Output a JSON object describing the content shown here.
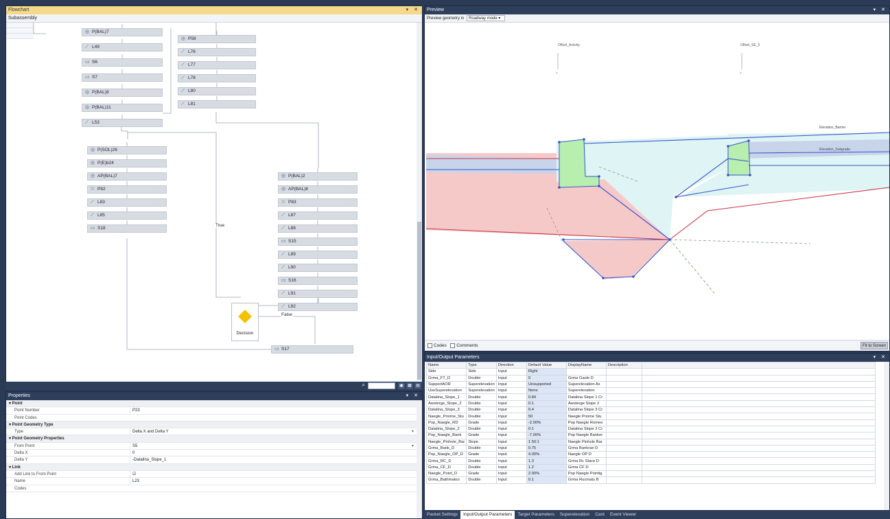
{
  "flowchart": {
    "title": "Flowchart",
    "tab": "Subassembly",
    "col1": [
      {
        "label": "P(BAL)7",
        "icon": "point"
      },
      {
        "label": "L49",
        "icon": "link"
      },
      {
        "label": "S6",
        "icon": "shape"
      },
      {
        "label": "S7",
        "icon": "shape"
      },
      {
        "label": "P(BAL)8",
        "icon": "point"
      },
      {
        "label": "P(BAL)11",
        "icon": "point"
      },
      {
        "label": "L53",
        "icon": "link"
      }
    ],
    "col2": [
      {
        "label": "P58",
        "icon": "point"
      },
      {
        "label": "L76",
        "icon": "link"
      },
      {
        "label": "L77",
        "icon": "link"
      },
      {
        "label": "L78",
        "icon": "link"
      },
      {
        "label": "L80",
        "icon": "link"
      },
      {
        "label": "L81",
        "icon": "link"
      }
    ],
    "col3": [
      {
        "label": "P(SOL)26",
        "icon": "point"
      },
      {
        "label": "P(E)b24",
        "icon": "point"
      },
      {
        "label": "AP(BAL)7",
        "icon": "point"
      },
      {
        "label": "P82",
        "icon": "cross"
      },
      {
        "label": "L83",
        "icon": "link"
      },
      {
        "label": "L85",
        "icon": "link"
      },
      {
        "label": "S18",
        "icon": "shape"
      }
    ],
    "col4": [
      {
        "label": "P(BAL)2",
        "icon": "point"
      },
      {
        "label": "AP(BAL)8",
        "icon": "point"
      },
      {
        "label": "P83",
        "icon": "cross"
      },
      {
        "label": "L87",
        "icon": "link"
      },
      {
        "label": "L88",
        "icon": "link"
      },
      {
        "label": "S15",
        "icon": "shape"
      },
      {
        "label": "L89",
        "icon": "link"
      },
      {
        "label": "L90",
        "icon": "link"
      },
      {
        "label": "S16",
        "icon": "shape"
      },
      {
        "label": "L91",
        "icon": "link"
      },
      {
        "label": "L92",
        "icon": "link"
      }
    ],
    "final_node": {
      "label": "S17",
      "icon": "shape"
    },
    "decision_label": "Decision",
    "true_label": "True",
    "false_label": "False"
  },
  "properties": {
    "title": "Properties",
    "rows": [
      {
        "kind": "cat",
        "name": "Point"
      },
      {
        "kind": "prop",
        "name": "Point Number",
        "value": "P23"
      },
      {
        "kind": "prop",
        "name": "Point Codes",
        "value": ""
      },
      {
        "kind": "cat",
        "name": "Point Geometry Type"
      },
      {
        "kind": "prop",
        "name": "Type",
        "value": "Delta X and Delta Y",
        "dropdown": true
      },
      {
        "kind": "cat",
        "name": "Point Geometry Properties"
      },
      {
        "kind": "prop",
        "name": "From Point",
        "value": "S5",
        "dropdown": true
      },
      {
        "kind": "prop",
        "name": "Delta X",
        "value": "0"
      },
      {
        "kind": "prop",
        "name": "Delta Y",
        "value": "-Datalina_Slope_1"
      },
      {
        "kind": "cat",
        "name": "Link"
      },
      {
        "kind": "prop",
        "name": "Add Link to From Point",
        "value": "☑"
      },
      {
        "kind": "prop",
        "name": "Name",
        "value": "L23"
      },
      {
        "kind": "prop",
        "name": "Codes",
        "value": ""
      }
    ]
  },
  "preview": {
    "title": "Preview",
    "toolbar_label": "Preview geometry in",
    "mode": "Roadway mode",
    "codes_label": "Codes",
    "comments_label": "Comments",
    "fit_button": "Fit to Screen",
    "marker_labels": [
      "Offset_Activity",
      "Offset_SE_5"
    ],
    "elevation_labels": [
      "Elevation_Barrier",
      "Elevation_Subgrade"
    ]
  },
  "io": {
    "title": "Input/Output Parameters",
    "headers": [
      "Name",
      "Type",
      "Direction",
      "Default Value",
      "DisplayName",
      "Description"
    ],
    "rows": [
      [
        "Side",
        "Side",
        "Input",
        "Right",
        "",
        ""
      ],
      [
        "Grma_FT_D",
        "Double",
        "Input",
        "0",
        "Grma Gasle D",
        ""
      ],
      [
        "SupportAOR",
        "Superelevation",
        "Input",
        "Unsupported",
        "Superelevation Ax",
        ""
      ],
      [
        "UseSuperelevation",
        "Superelevation",
        "Input",
        "None",
        "Superelevation",
        ""
      ],
      [
        "Datalina_Slope_1",
        "Double",
        "Input",
        "0.84",
        "Datalina Slope 1 Cr",
        ""
      ],
      [
        "Awsterge_Slope_2",
        "Double",
        "Input",
        "0.1",
        "Awsterge Slope 2",
        ""
      ],
      [
        "Datalina_Slope_3",
        "Double",
        "Input",
        "0.4",
        "Datalina Slope 3 Cr",
        ""
      ],
      [
        "Naegle_Priome_Stu",
        "Double",
        "Input",
        "50",
        "Naegle Priome Stu",
        ""
      ],
      [
        "Pop_Naegle_RD",
        "Grade",
        "Input",
        "-2.00%",
        "Pop Naegle Romeo",
        ""
      ],
      [
        "Datalina_Slope_2",
        "Double",
        "Input",
        "0.1",
        "Datalina Slope 2 Cr",
        ""
      ],
      [
        "Pop_Naegle_Bank",
        "Grade",
        "Input",
        "-7.00%",
        "Pop Naegle Banker",
        ""
      ],
      [
        "Naegle_Pinhole_Bar",
        "Slope",
        "Input",
        "1.50:1",
        "Naegle Pinhole Bar",
        ""
      ],
      [
        "Grma_Bank_D",
        "Double",
        "Input",
        "0.75",
        "Grma Bankrae D",
        ""
      ],
      [
        "Pop_Naegle_OP_D",
        "Grade",
        "Input",
        "4.00%",
        "Naegle OP D",
        ""
      ],
      [
        "Grma_RC_D",
        "Double",
        "Input",
        "1.3",
        "Grma Rc Slace D",
        ""
      ],
      [
        "Grma_CF_D",
        "Double",
        "Input",
        "1.2",
        "Grma CF D",
        ""
      ],
      [
        "Naegle_Point_D",
        "Grade",
        "Input",
        "2.00%",
        "Pop Naegle Pointig",
        ""
      ],
      [
        "Grma_Bathmatoo",
        "Double",
        "Input",
        "0.1",
        "Grma Rucmatu B",
        ""
      ]
    ]
  },
  "bottom_tabs": [
    "Packet Settings",
    "Input/Output Parameters",
    "Target Parameters",
    "Superelevation",
    "Cant",
    "Event Viewer"
  ],
  "colors": {
    "title_bar": "#2e3f5c",
    "node_bg": "#d7dbe2",
    "decision": "#f2c200",
    "fill_red": "#f6c9c9",
    "fill_cyan": "#dff4f4",
    "fill_green": "#b8efae",
    "fill_blue": "#c8d4ea"
  }
}
